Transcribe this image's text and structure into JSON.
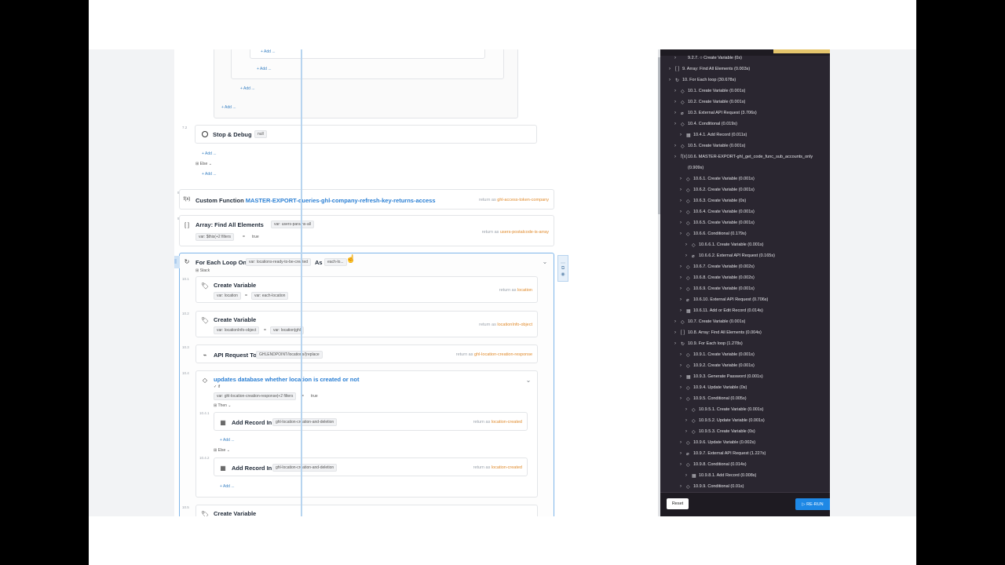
{
  "flow": {
    "add_label": "+ Add ...",
    "stop_debug": {
      "num": "7.2",
      "title": "Stop & Debug",
      "chip": "null"
    },
    "else_label": "Else",
    "custom_function": {
      "num": "8",
      "prefix": "Custom Function",
      "name": "MASTER-EXPORT-queries-ghl-company-refresh-key-returns-access",
      "return_prefix": "return as",
      "return_var": "ghl-access-token-company"
    },
    "find_all": {
      "num": "9",
      "title": "Array: Find All Elements",
      "chip": "var: users-params-all",
      "filter": "var: $this(+2 filters",
      "op": "=",
      "val": "true",
      "return_prefix": "return as",
      "return_var": "users-postalcode-is-array"
    },
    "for_each": {
      "title": "For Each Loop On",
      "chip": "var: locations-ready-to-be-created",
      "as": "As",
      "as_chip": "each-lo...",
      "stack": "Stack"
    },
    "cv1": {
      "num": "10.1",
      "title": "Create Variable",
      "chip1": "var: location",
      "op": "=",
      "chip2": "var: each-location",
      "return_prefix": "return as",
      "return_var": "location"
    },
    "cv2": {
      "num": "10.2",
      "title": "Create Variable",
      "chip1": "var: locationInfo-object",
      "op": "=",
      "chip2": "var: location|ghl",
      "return_prefix": "return as",
      "return_var": "locationInfo-object"
    },
    "api": {
      "num": "10.3",
      "title": "API Request To",
      "chip": "GHLENDPOINT/locations/(replace",
      "return_prefix": "return as",
      "return_var": "ghl-location-creation-response"
    },
    "cond": {
      "num": "10.4",
      "title": "updates database whether location is created or not",
      "check": "✓ if",
      "filter": "var: ghl-location-creation-response|+2 filters",
      "op": "=",
      "val": "true",
      "then": "Then",
      "else": "Else"
    },
    "add1": {
      "num": "10.4.1",
      "title": "Add Record In",
      "chip": "ghl-location-creation-and-deletion",
      "return_prefix": "return as",
      "return_var": "location-created"
    },
    "add2": {
      "num": "10.4.2",
      "title": "Add Record In",
      "chip": "ghl-location-creation-and-deletion",
      "return_prefix": "return as",
      "return_var": "location-created"
    },
    "cv3": {
      "num": "10.5",
      "title": "Create Variable"
    }
  },
  "panel": {
    "rows": [
      {
        "indent": 2,
        "label": "9.2.7. ○ Create Variable (0s)"
      },
      {
        "indent": 1,
        "icon": "[ ]",
        "label": "9. Array: Find All Elements (0.003s)"
      },
      {
        "indent": 1,
        "icon": "↻",
        "label": "10. For Each loop (30.678s)"
      },
      {
        "indent": 2,
        "icon": "◇",
        "label": "10.1. Create Variable (0.001s)"
      },
      {
        "indent": 2,
        "icon": "◇",
        "label": "10.2. Create Variable (0.001s)"
      },
      {
        "indent": 2,
        "icon": "⌀",
        "label": "10.3. External API Request (3.706s)"
      },
      {
        "indent": 2,
        "icon": "◇",
        "label": "10.4. Conditional (0.019s)"
      },
      {
        "indent": 3,
        "icon": "▦",
        "label": "10.4.1. Add Record (0.011s)"
      },
      {
        "indent": 2,
        "icon": "◇",
        "label": "10.5. Create Variable (0.001s)"
      },
      {
        "indent": 2,
        "icon": "f(x)",
        "label": "10.6. MASTER-EXPORT-ghl_get_code_func_sub_accounts_only"
      },
      {
        "indent": 2,
        "icon": "",
        "label": "(0.909s)"
      },
      {
        "indent": 3,
        "icon": "◇",
        "label": "10.6.1. Create Variable (0.001s)"
      },
      {
        "indent": 3,
        "icon": "◇",
        "label": "10.6.2. Create Variable (0.001s)"
      },
      {
        "indent": 3,
        "icon": "◇",
        "label": "10.6.3. Create Variable (0s)"
      },
      {
        "indent": 3,
        "icon": "◇",
        "label": "10.6.4. Create Variable (0.001s)"
      },
      {
        "indent": 3,
        "icon": "◇",
        "label": "10.6.5. Create Variable (0.001s)"
      },
      {
        "indent": 3,
        "icon": "◇",
        "label": "10.6.6. Conditional (0.179s)"
      },
      {
        "indent": 4,
        "icon": "◇",
        "label": "10.6.6.1. Create Variable (0.001s)"
      },
      {
        "indent": 4,
        "icon": "⌀",
        "label": "10.6.6.2. External API Request (0.165s)"
      },
      {
        "indent": 3,
        "icon": "◇",
        "label": "10.6.7. Create Variable (0.002s)"
      },
      {
        "indent": 3,
        "icon": "◇",
        "label": "10.6.8. Create Variable (0.002s)"
      },
      {
        "indent": 3,
        "icon": "◇",
        "label": "10.6.9. Create Variable (0.001s)"
      },
      {
        "indent": 3,
        "icon": "⌀",
        "label": "10.6.10. External API Request (0.706s)"
      },
      {
        "indent": 3,
        "icon": "▦",
        "label": "10.6.11. Add or Edit Record (0.014s)"
      },
      {
        "indent": 2,
        "icon": "◇",
        "label": "10.7. Create Variable (0.001s)"
      },
      {
        "indent": 2,
        "icon": "[ ]",
        "label": "10.8. Array: Find All Elements (0.004s)"
      },
      {
        "indent": 2,
        "icon": "↻",
        "label": "10.9. For Each loop (1.278s)"
      },
      {
        "indent": 3,
        "icon": "◇",
        "label": "10.9.1. Create Variable (0.001s)"
      },
      {
        "indent": 3,
        "icon": "◇",
        "label": "10.9.2. Create Variable (0.001s)"
      },
      {
        "indent": 3,
        "icon": "▦",
        "label": "10.9.3. Generate Password (0.001s)"
      },
      {
        "indent": 3,
        "icon": "◇",
        "label": "10.9.4. Update Variable (0s)"
      },
      {
        "indent": 3,
        "icon": "◇",
        "label": "10.9.5. Conditional (0.005s)"
      },
      {
        "indent": 4,
        "icon": "◇",
        "label": "10.9.5.1. Create Variable (0.001s)"
      },
      {
        "indent": 4,
        "icon": "◇",
        "label": "10.9.5.2. Update Variable (0.001s)"
      },
      {
        "indent": 4,
        "icon": "◇",
        "label": "10.9.5.3. Create Variable (0s)"
      },
      {
        "indent": 3,
        "icon": "◇",
        "label": "10.9.6. Update Variable (0.002s)"
      },
      {
        "indent": 3,
        "icon": "⌀",
        "label": "10.9.7. External API Request (1.227s)"
      },
      {
        "indent": 3,
        "icon": "◇",
        "label": "10.9.8. Conditional (0.014s)"
      },
      {
        "indent": 4,
        "icon": "▦",
        "label": "10.9.8.1. Add Record (0.008s)"
      },
      {
        "indent": 3,
        "icon": "◇",
        "label": "10.9.9. Conditional (0.01s)"
      }
    ],
    "reset_label": "Reset",
    "rerun_label": "▷ RE-RUN"
  },
  "colors": {
    "accent": "#2a7fd4",
    "return_var": "#e08a2b",
    "panel_bg": "#2a2630",
    "rerun": "#1e88e5"
  }
}
